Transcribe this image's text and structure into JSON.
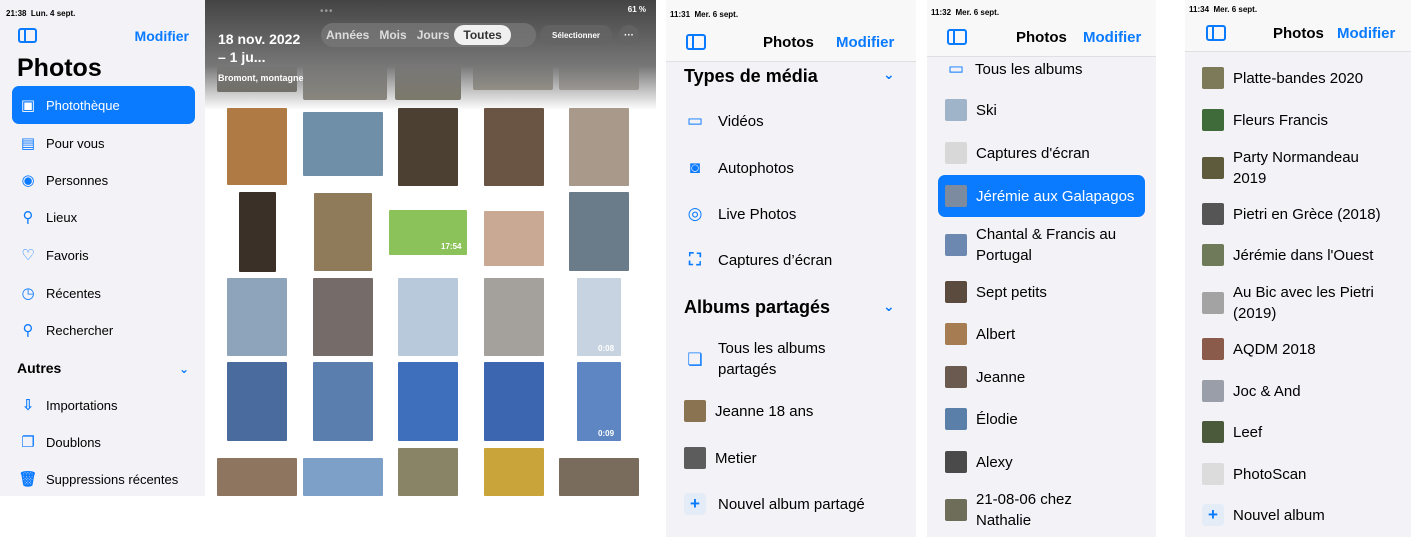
{
  "panel1": {
    "status_time": "21:38",
    "status_date": "Lun. 4 sept.",
    "status_battery": "61 %",
    "edit_label": "Modifier",
    "title": "Photos",
    "sidebar_items": [
      {
        "label": "Photothèque",
        "icon": "photo-library-icon",
        "selected": true
      },
      {
        "label": "Pour vous",
        "icon": "for-you-icon"
      },
      {
        "label": "Personnes",
        "icon": "people-icon"
      },
      {
        "label": "Lieux",
        "icon": "places-icon"
      },
      {
        "label": "Favoris",
        "icon": "heart-icon"
      },
      {
        "label": "Récentes",
        "icon": "clock-icon"
      },
      {
        "label": "Rechercher",
        "icon": "search-icon"
      }
    ],
    "section_label": "Autres",
    "other_items": [
      {
        "label": "Importations",
        "icon": "import-icon"
      },
      {
        "label": "Doublons",
        "icon": "duplicates-icon"
      },
      {
        "label": "Suppressions récentes",
        "icon": "trash-icon"
      }
    ],
    "grid_date": "18 nov. 2022 – 1 ju...",
    "grid_location": "Bromont, montagne",
    "segments": [
      "Années",
      "Mois",
      "Jours",
      "Toutes"
    ],
    "active_segment": "Toutes",
    "select_label": "Sélectionner",
    "more_label": "···",
    "durations": {
      "d1": "17:54",
      "d2": "0:08",
      "d3": "0:09"
    }
  },
  "panel2": {
    "status_time": "11:31",
    "status_date": "Mer. 6 sept.",
    "title": "Photos",
    "edit_label": "Modifier",
    "section_media": "Types de média",
    "media_items": [
      "Vidéos",
      "Autophotos",
      "Live Photos",
      "Captures d’écran"
    ],
    "section_shared": "Albums partagés",
    "shared_items": [
      "Tous les albums partagés",
      "Jeanne 18 ans",
      "Metier",
      "Nouvel album partagé"
    ]
  },
  "panel3": {
    "status_time": "11:32",
    "status_date": "Mer. 6 sept.",
    "title": "Photos",
    "edit_label": "Modifier",
    "albums": [
      "Tous les albums",
      "Ski",
      "Captures d'écran",
      "Jérémie aux Galapagos",
      "Chantal & Francis au Portugal",
      "Sept petits",
      "Albert",
      "Jeanne",
      "Élodie",
      "Alexy",
      "21-08-06 chez Nathalie"
    ],
    "selected_album": "Jérémie aux Galapagos"
  },
  "panel4": {
    "status_time": "11:34",
    "status_date": "Mer. 6 sept.",
    "title": "Photos",
    "edit_label": "Modifier",
    "albums": [
      "Platte-bandes 2020",
      "Fleurs Francis",
      "Party Normandeau 2019",
      "Pietri en Grèce (2018)",
      "Jérémie dans l'Ouest",
      "Au Bic avec les Pietri (2019)",
      "AQDM 2018",
      "Joc & And",
      "Leef",
      "PhotoScan",
      "Nouvel album"
    ]
  }
}
